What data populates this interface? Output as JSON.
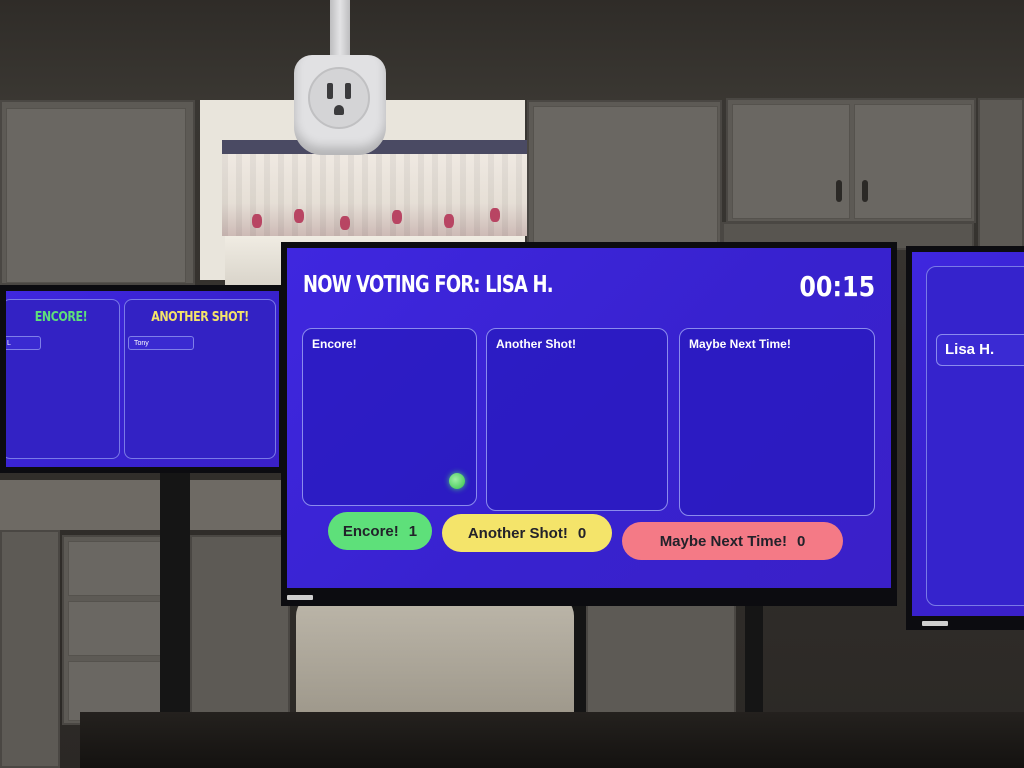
{
  "center_screen": {
    "title": "NOW VOTING FOR: LISA H.",
    "timer": "00:15",
    "columns": [
      {
        "title": "Encore!"
      },
      {
        "title": "Another Shot!"
      },
      {
        "title": "Maybe Next Time!"
      }
    ],
    "tallies": [
      {
        "label": "Encore!",
        "count": "1",
        "color": "#5ee07a"
      },
      {
        "label": "Another Shot!",
        "count": "0",
        "color": "#f4e46a"
      },
      {
        "label": "Maybe Next Time!",
        "count": "0",
        "color": "#f47a86"
      }
    ]
  },
  "left_screen": {
    "columns": [
      {
        "title": "ENCORE!",
        "color": "#5ee07a",
        "chips": [
          "L"
        ]
      },
      {
        "title": "ANOTHER SHOT!",
        "color": "#f4e46a",
        "chips": [
          "Tony"
        ]
      }
    ]
  },
  "right_screen": {
    "chip": "Lisa H."
  },
  "colors": {
    "screen_blue": "#3a22d6",
    "border_lavender": "#8b8bed"
  }
}
